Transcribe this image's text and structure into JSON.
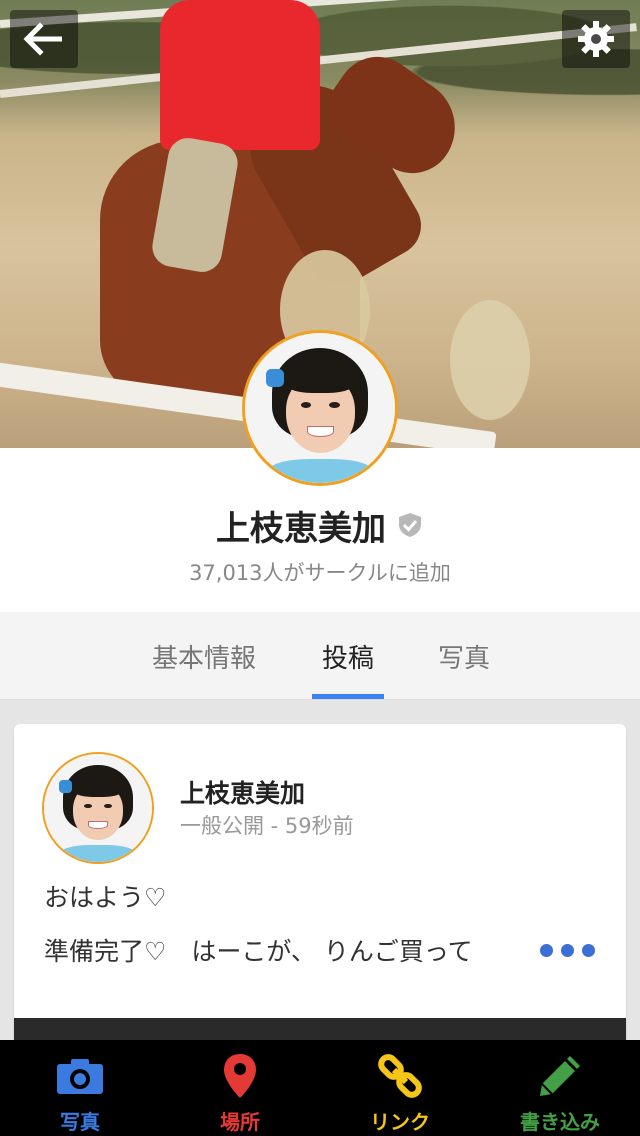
{
  "header": {
    "back_icon": "arrow-left-icon",
    "settings_icon": "gear-icon"
  },
  "profile": {
    "name": "上枝恵美加",
    "verified_icon": "verified-shield-icon",
    "followers_text": "37,013人がサークルに追加"
  },
  "tabs": [
    {
      "label": "基本情報",
      "active": false
    },
    {
      "label": "投稿",
      "active": true
    },
    {
      "label": "写真",
      "active": false
    }
  ],
  "post": {
    "author": "上枝恵美加",
    "meta": "一般公開 - 59秒前",
    "line1": "おはよう♡",
    "line2": "準備完了♡　はーこが、 りんご買って"
  },
  "bottom_nav": [
    {
      "label": "写真",
      "icon": "camera-icon",
      "color": "#3b7be0"
    },
    {
      "label": "場所",
      "icon": "map-pin-icon",
      "color": "#e53935"
    },
    {
      "label": "リンク",
      "icon": "link-icon",
      "color": "#f5c518"
    },
    {
      "label": "書き込み",
      "icon": "pencil-icon",
      "color": "#43a047"
    }
  ],
  "colors": {
    "accent": "#3b82f6",
    "avatar_ring": "#f0a020"
  }
}
